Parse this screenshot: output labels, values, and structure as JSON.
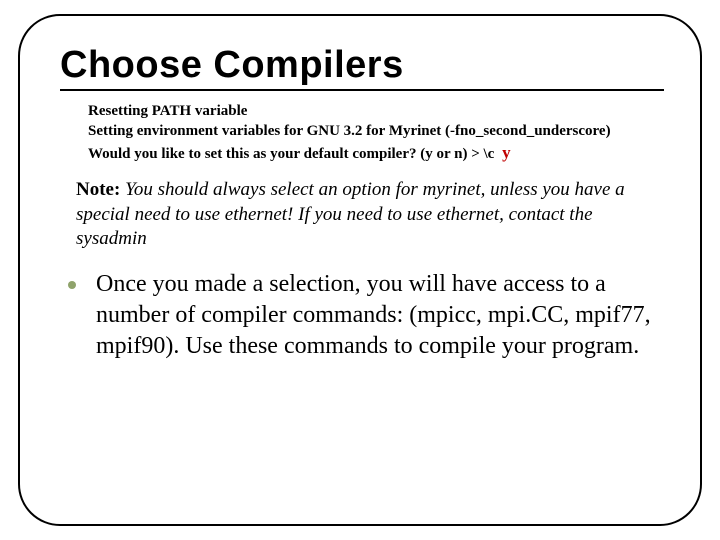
{
  "title": "Choose Compilers",
  "terminal": {
    "line1": "Resetting PATH variable",
    "line2": "Setting environment variables for GNU 3.2 for Myrinet (-fno_second_underscore)",
    "line3": "Would you like to set this as your default compiler? (y or n) > \\c",
    "answer": "y"
  },
  "note": {
    "label": "Note:",
    "text": "You should always select an option for myrinet, unless you have a special need to use ethernet! If you need to use ethernet, contact the sysadmin"
  },
  "body": "Once you made a selection, you will have access to a number of compiler commands: (mpicc, mpi.CC, mpif77, mpif90). Use these commands to compile your program."
}
